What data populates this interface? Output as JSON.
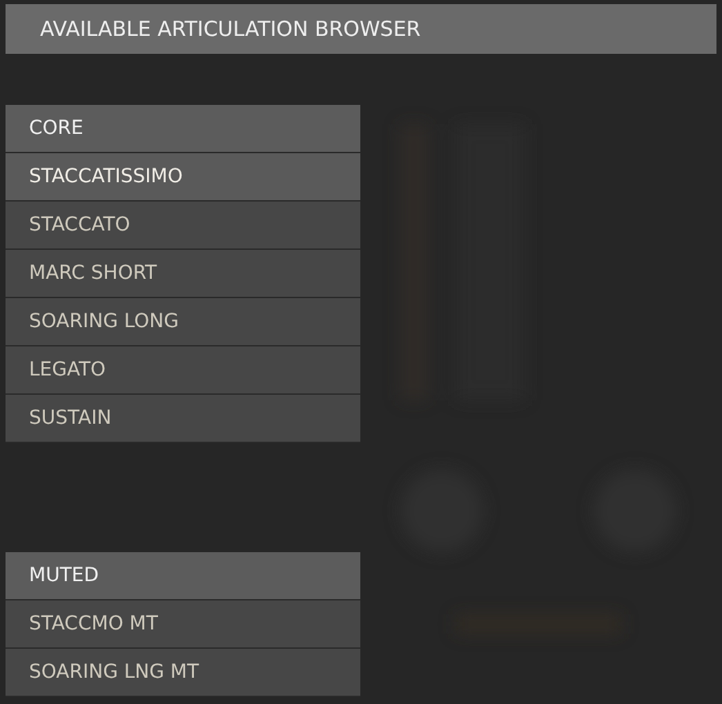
{
  "title": "AVAILABLE ARTICULATION BROWSER",
  "groups": [
    {
      "items": [
        {
          "kind": "header",
          "label": "CORE"
        },
        {
          "kind": "item",
          "label": "STACCATISSIMO",
          "selected": true
        },
        {
          "kind": "item",
          "label": "STACCATO",
          "selected": false
        },
        {
          "kind": "item",
          "label": "MARC SHORT",
          "selected": false
        },
        {
          "kind": "item",
          "label": "SOARING LONG",
          "selected": false
        },
        {
          "kind": "item",
          "label": "LEGATO",
          "selected": false
        },
        {
          "kind": "item",
          "label": "SUSTAIN",
          "selected": false
        }
      ]
    },
    {
      "items": [
        {
          "kind": "header",
          "label": "MUTED"
        },
        {
          "kind": "item",
          "label": "STACCMO MT",
          "selected": false
        },
        {
          "kind": "item",
          "label": "SOARING LNG MT",
          "selected": false
        }
      ]
    }
  ]
}
